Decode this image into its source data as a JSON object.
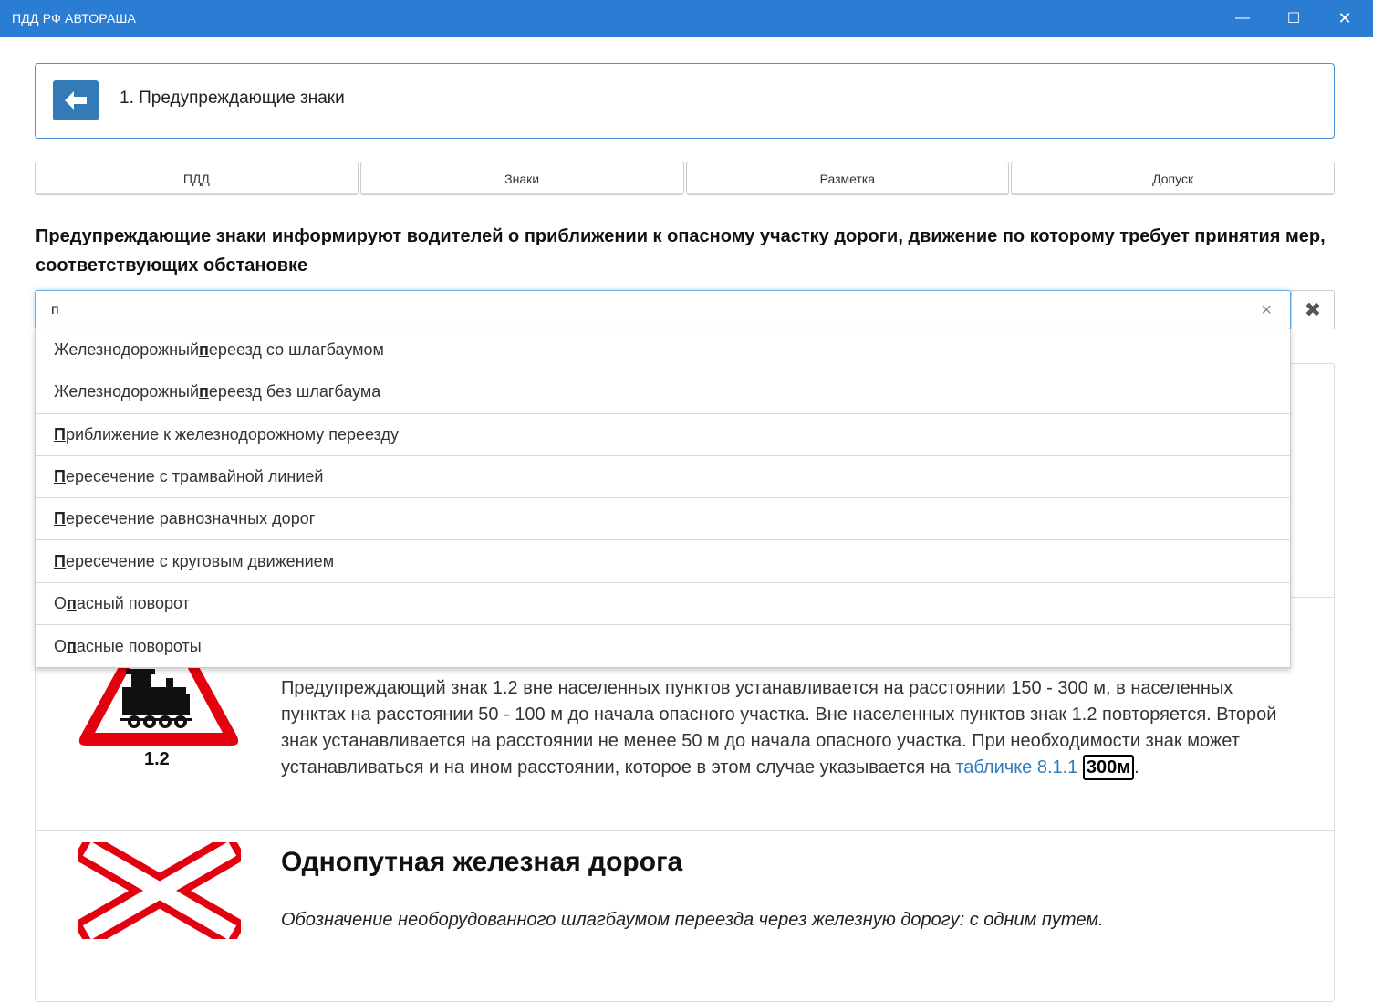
{
  "window": {
    "title": "ПДД РФ АВТОРАША",
    "minimize_glyph": "—",
    "maximize_glyph": "☐",
    "close_glyph": "✕"
  },
  "header": {
    "back_icon": "arrow-left-icon",
    "title": "1. Предупреждающие знаки"
  },
  "tabs": [
    {
      "label": "ПДД"
    },
    {
      "label": "Знаки"
    },
    {
      "label": "Разметка"
    },
    {
      "label": "Допуск"
    }
  ],
  "description": "Предупреждающие знаки информируют водителей о приближении к опасному участку дороги, движение по которому требует принятия мер, соответствующих обстановке",
  "search": {
    "value": "п",
    "clear_glyph": "×",
    "reset_glyph": "✖"
  },
  "suggestions": [
    {
      "before": "Железнодорожный ",
      "match": "п",
      "after": "ереезд со шлагбаумом"
    },
    {
      "before": "Железнодорожный ",
      "match": "п",
      "after": "ереезд без шлагбаума"
    },
    {
      "before": "",
      "match": "П",
      "after": "риближение к железнодорожному переезду"
    },
    {
      "before": "",
      "match": "П",
      "after": "ересечение с трамвайной линией"
    },
    {
      "before": "",
      "match": "П",
      "after": "ересечение равнозначных дорог"
    },
    {
      "before": "",
      "match": "П",
      "after": "ересечение с круговым движением"
    },
    {
      "before": "О",
      "match": "п",
      "after": "асный поворот"
    },
    {
      "before": "О",
      "match": "п",
      "after": "асные повороты"
    }
  ],
  "sign_1_2": {
    "number": "1.2",
    "text_main": "Предупреждающий знак 1.2 вне населенных пунктов устанавливается на расстоянии 150 - 300 м, в населенных пунктах на расстоянии 50 - 100 м до начала опасного участка. Вне населенных пунктов знак 1.2 повторяется. Второй знак устанавливается на расстоянии не менее 50 м до начала опасного участка. При необходимости знак может устанавливаться и на ином расстоянии, которое в этом случае указывается на ",
    "link": "табличке 8.1.1",
    "plate": "300м",
    "tail": "."
  },
  "sign_1_3": {
    "title": "Однопутная железная дорога",
    "desc": "Обозначение необорудованного шлагбаумом переезда через железную дорогу: с одним путем."
  },
  "colors": {
    "titlebar": "#2b7cd3",
    "primary": "#337ab7",
    "sign_red": "#e3000f"
  }
}
